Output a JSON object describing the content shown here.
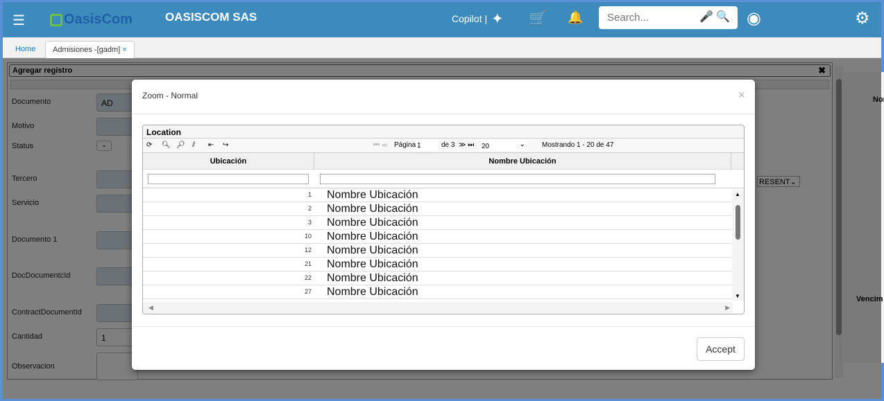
{
  "header": {
    "logo_text": "OasisCom",
    "company": "OASISCOM SAS",
    "copilot": "Copilot |",
    "search_placeholder": "Search..."
  },
  "tabs": [
    {
      "label": "Home"
    },
    {
      "label": "Admisiones -[gadm]",
      "close": "×"
    }
  ],
  "form": {
    "title": "Agregar registro",
    "fields": [
      {
        "label": "Documento",
        "value": "AD"
      },
      {
        "label": "Motivo",
        "value": ""
      },
      {
        "label": "Status",
        "value": ""
      },
      {
        "label": "Tercero",
        "value": ""
      },
      {
        "label": "Servicio",
        "value": ""
      },
      {
        "label": "Documento 1",
        "value": ""
      },
      {
        "label": "DocDocumentcId",
        "value": ""
      },
      {
        "label": "ContractDocumentId",
        "value": ""
      },
      {
        "label": "Cantidad",
        "value": "1"
      },
      {
        "label": "Observacion",
        "value": ""
      }
    ],
    "select_partial": "RESENT"
  },
  "right_pane": {
    "col1": "Nor",
    "col2": "Vencim"
  },
  "modal": {
    "title": "Zoom - Normal",
    "close": "×",
    "accept": "Accept",
    "grid": {
      "caption": "Location",
      "page_label": "Página",
      "page": "1",
      "of": "de 3",
      "page_size": "20",
      "showing": "Mostrando 1 - 20 de 47",
      "columns": [
        "Ubicación",
        "Nombre Ubicación"
      ],
      "rows": [
        {
          "id": "1",
          "name": "Nombre Ubicación"
        },
        {
          "id": "2",
          "name": "Nombre Ubicación"
        },
        {
          "id": "3",
          "name": "Nombre Ubicación"
        },
        {
          "id": "10",
          "name": "Nombre Ubicación"
        },
        {
          "id": "12",
          "name": "Nombre Ubicación"
        },
        {
          "id": "21",
          "name": "Nombre Ubicación"
        },
        {
          "id": "22",
          "name": "Nombre Ubicación"
        },
        {
          "id": "27",
          "name": "Nombre Ubicación"
        }
      ]
    }
  }
}
